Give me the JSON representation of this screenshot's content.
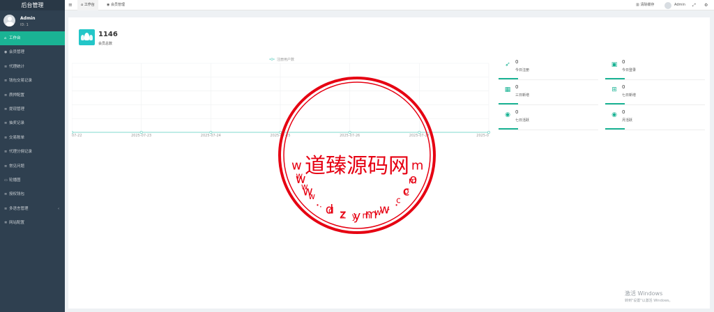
{
  "sidebar": {
    "brand": "后台管理",
    "user_name": "Admin",
    "user_id": "ID: 1",
    "items": [
      {
        "label": "工作台",
        "icon": "dashboard-icon"
      },
      {
        "label": "会员管理",
        "icon": "user-circle-icon"
      },
      {
        "label": "代理统计",
        "icon": "list-icon"
      },
      {
        "label": "钱包交易记录",
        "icon": "list-icon"
      },
      {
        "label": "质押配置",
        "icon": "list-icon"
      },
      {
        "label": "提现管理",
        "icon": "list-icon"
      },
      {
        "label": "抽奖记录",
        "icon": "list-icon"
      },
      {
        "label": "交易账单",
        "icon": "list-icon"
      },
      {
        "label": "代理分佣记录",
        "icon": "list-icon"
      },
      {
        "label": "常见问题",
        "icon": "list-icon"
      },
      {
        "label": "轮播图",
        "icon": "image-icon"
      },
      {
        "label": "授权钱包",
        "icon": "list-icon"
      },
      {
        "label": "多语言管理",
        "icon": "list-icon"
      },
      {
        "label": "网站配置",
        "icon": "gear-icon"
      }
    ]
  },
  "topbar": {
    "tab_workbench": "工作台",
    "tab_members": "会员管理",
    "clear_cache": "清除缓存",
    "admin": "Admin"
  },
  "summary": {
    "value": "1146",
    "label": "会员总数"
  },
  "chart_data": {
    "type": "line",
    "legend": "注册用户数",
    "x": [
      "07-22",
      "2025-07-23",
      "2025-07-24",
      "2025-07-25",
      "2025-07-26",
      "2025-07-27",
      "2025-0"
    ],
    "series": [
      {
        "name": "注册用户数",
        "values": [
          0,
          0,
          0,
          0,
          0,
          0,
          0
        ]
      }
    ],
    "grid": true,
    "legend_position": "top-center"
  },
  "cards": [
    {
      "value": "0",
      "label": "今日注册",
      "icon": "rocket-icon"
    },
    {
      "value": "0",
      "label": "今日登录",
      "icon": "id-card-icon"
    },
    {
      "value": "0",
      "label": "三日新增",
      "icon": "calendar-icon"
    },
    {
      "value": "0",
      "label": "七日新增",
      "icon": "calendar-plus-icon"
    },
    {
      "value": "0",
      "label": "七日活跃",
      "icon": "user-circle-icon"
    },
    {
      "value": "0",
      "label": "月活跃",
      "icon": "user-circle-icon"
    }
  ],
  "watermark": {
    "text": "道臻源码网",
    "url": "www.dzymw.com"
  },
  "windows": {
    "line1": "激活 Windows",
    "line2": "转到\"设置\"以激活 Windows。"
  },
  "colors": {
    "sidebar": "#2f4050",
    "accent": "#1ab394",
    "stamp": "#e60012"
  }
}
